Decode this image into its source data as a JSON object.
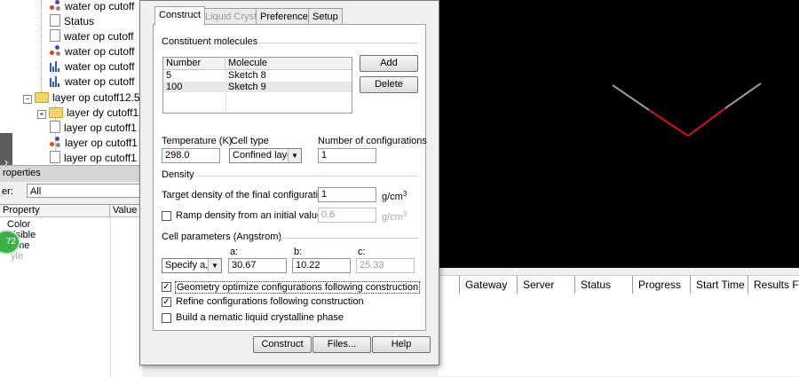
{
  "tree": {
    "items": [
      {
        "label": "water  op  cutoff",
        "icon": "molecule-icon"
      },
      {
        "label": "Status",
        "icon": "document-icon"
      },
      {
        "label": "water  op  cutoff",
        "icon": "document-icon"
      },
      {
        "label": "water  op  cutoff",
        "icon": "molecule-icon"
      },
      {
        "label": "water  op  cutoff",
        "icon": "bar-chart-icon"
      },
      {
        "label": "water  op  cutoff",
        "icon": "bar-chart-icon"
      },
      {
        "label": "layer  op  cutoff12.5",
        "icon": "folder-icon"
      },
      {
        "label": "layer dy  cutoff12",
        "icon": "folder-icon"
      },
      {
        "label": "layer  op  cutoff1",
        "icon": "document-icon"
      },
      {
        "label": "layer  op  cutoff1",
        "icon": "molecule-icon"
      },
      {
        "label": "layer  op  cutoff1",
        "icon": "document-icon"
      }
    ]
  },
  "edge_tab": {
    "glyph": "›"
  },
  "properties": {
    "title": "roperties",
    "filter_label": "er:",
    "filter_value": "All",
    "columns": [
      "Property",
      "Value"
    ],
    "rows": [
      "Color",
      "Visible",
      "ame",
      "yle"
    ],
    "badge": "72"
  },
  "jobs": {
    "columns": [
      "Gateway",
      "Server",
      "Status",
      "Progress",
      "Start Time",
      "Results Fo"
    ]
  },
  "dialog": {
    "tabs": [
      {
        "label": "Construct",
        "state": "active"
      },
      {
        "label": "Liquid Crystal",
        "state": "disabled"
      },
      {
        "label": "Preferences",
        "state": "normal"
      },
      {
        "label": "Setup",
        "state": "normal"
      }
    ],
    "constituent": {
      "title": "Constituent molecules",
      "columns": [
        "Number",
        "Molecule"
      ],
      "rows": [
        {
          "number": "5",
          "molecule": "Sketch 8"
        },
        {
          "number": "100",
          "molecule": "Sketch 9"
        }
      ],
      "add_label": "Add",
      "delete_label": "Delete"
    },
    "temperature": {
      "label": "Temperature (K)",
      "value": "298.0"
    },
    "cell_type": {
      "label": "Cell type",
      "value": "Confined layer"
    },
    "num_configs": {
      "label": "Number of configurations",
      "value": "1"
    },
    "density": {
      "title": "Density",
      "target_label": "Target density of the final configurations:",
      "target_value": "1",
      "target_unit": "g/cm",
      "ramp_label": "Ramp density from an initial value of:",
      "ramp_value": "0.6",
      "ramp_unit": "g/cm",
      "unit_exp": "3"
    },
    "cell_params": {
      "title": "Cell parameters (Angstrom)",
      "mode": "Specify a, b",
      "a_label": "a:",
      "b_label": "b:",
      "c_label": "c:",
      "a": "30.67",
      "b": "10.22",
      "c": "25.33"
    },
    "options": [
      {
        "label": "Geometry optimize configurations following construction",
        "checked": true
      },
      {
        "label": "Refine configurations following construction",
        "checked": true
      },
      {
        "label": "Build a nematic liquid crystalline phase",
        "checked": false
      }
    ],
    "buttons": {
      "construct": "Construct",
      "files": "Files...",
      "help": "Help"
    }
  },
  "viewport": {
    "bond_colors": {
      "outer": "#9a9a9a",
      "inner": "#e01010"
    },
    "background": "#000000"
  }
}
